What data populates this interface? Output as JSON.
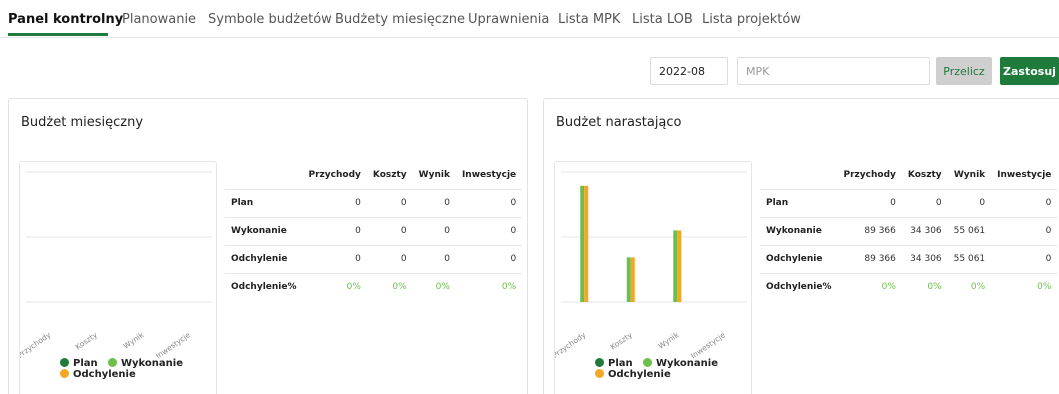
{
  "tabs": [
    {
      "label": "Panel kontrolny",
      "active": true
    },
    {
      "label": "Planowanie"
    },
    {
      "label": "Symbole budżetów"
    },
    {
      "label": "Budżety miesięczne"
    },
    {
      "label": "Uprawnienia"
    },
    {
      "label": "Lista MPK"
    },
    {
      "label": "Lista LOB"
    },
    {
      "label": "Lista projektów"
    }
  ],
  "toolbar": {
    "month_value": "2022-08",
    "mpk_placeholder": "MPK",
    "recalc_label": "Przelicz",
    "apply_label": "Zastosuj"
  },
  "colors": {
    "plan": "#1e7b3c",
    "wykonanie": "#6cbf4a",
    "odchylenie": "#f5a623",
    "accent": "#1e7b3c"
  },
  "panels": {
    "monthly": {
      "title": "Budżet miesięczny",
      "columns": [
        "Przychody",
        "Koszty",
        "Wynik",
        "Inwestycje"
      ],
      "rows": [
        {
          "label": "Plan",
          "values": [
            "0",
            "0",
            "0",
            "0"
          ]
        },
        {
          "label": "Wykonanie",
          "values": [
            "0",
            "0",
            "0",
            "0"
          ]
        },
        {
          "label": "Odchylenie",
          "values": [
            "0",
            "0",
            "0",
            "0"
          ]
        },
        {
          "label": "Odchylenie%",
          "values": [
            "0%",
            "0%",
            "0%",
            "0%"
          ]
        }
      ]
    },
    "cumulative": {
      "title": "Budżet narastająco",
      "columns": [
        "Przychody",
        "Koszty",
        "Wynik",
        "Inwestycje"
      ],
      "rows": [
        {
          "label": "Plan",
          "values": [
            "0",
            "0",
            "0",
            "0"
          ]
        },
        {
          "label": "Wykonanie",
          "values": [
            "89 366",
            "34 306",
            "55 061",
            "0"
          ]
        },
        {
          "label": "Odchylenie",
          "values": [
            "89 366",
            "34 306",
            "55 061",
            "0"
          ]
        },
        {
          "label": "Odchylenie%",
          "values": [
            "0%",
            "0%",
            "0%",
            "0%"
          ]
        }
      ]
    }
  },
  "chart_data": [
    {
      "type": "bar",
      "categories": [
        "Przychody",
        "Koszty",
        "Wynik",
        "Inwestycje"
      ],
      "series": [
        {
          "name": "Plan",
          "values": [
            0,
            0,
            0,
            0
          ]
        },
        {
          "name": "Wykonanie",
          "values": [
            0,
            0,
            0,
            0
          ]
        },
        {
          "name": "Odchylenie",
          "values": [
            0,
            0,
            0,
            0
          ]
        }
      ],
      "ylim": [
        0,
        100000
      ],
      "grid": true,
      "legend": "bottom"
    },
    {
      "type": "bar",
      "categories": [
        "Przychody",
        "Koszty",
        "Wynik",
        "Inwestycje"
      ],
      "series": [
        {
          "name": "Plan",
          "values": [
            0,
            0,
            0,
            0
          ]
        },
        {
          "name": "Wykonanie",
          "values": [
            89366,
            34306,
            55061,
            0
          ]
        },
        {
          "name": "Odchylenie",
          "values": [
            89366,
            34306,
            55061,
            0
          ]
        }
      ],
      "ylim": [
        0,
        100000
      ],
      "grid": true,
      "legend": "bottom"
    }
  ]
}
